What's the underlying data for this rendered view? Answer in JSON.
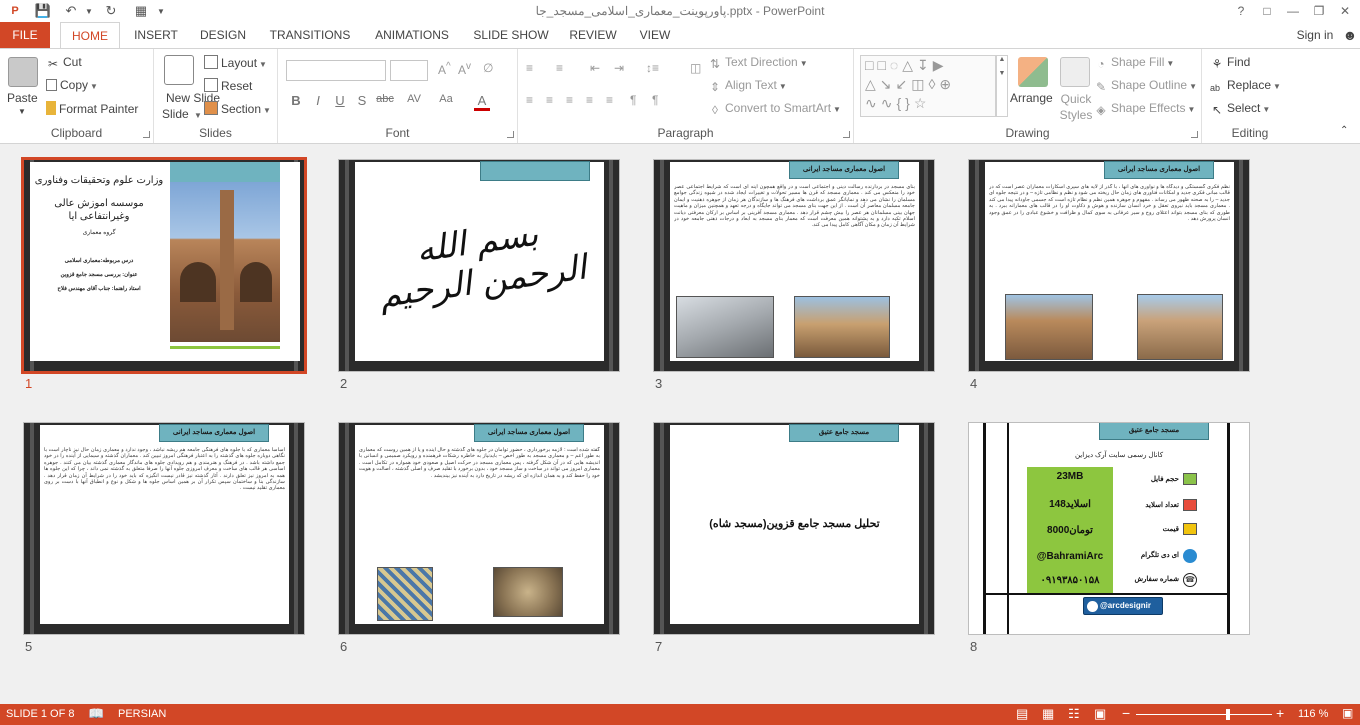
{
  "window": {
    "title": "پاورپوینت_معماری_اسلامی_مسجد_جا.pptx - PowerPoint",
    "help": "?",
    "sign_in": "Sign in"
  },
  "tabs": [
    "FILE",
    "HOME",
    "INSERT",
    "DESIGN",
    "TRANSITIONS",
    "ANIMATIONS",
    "SLIDE SHOW",
    "REVIEW",
    "VIEW"
  ],
  "ribbon": {
    "clipboard": {
      "label": "Clipboard",
      "paste": "Paste",
      "cut": "Cut",
      "copy": "Copy",
      "format_painter": "Format Painter"
    },
    "slides": {
      "label": "Slides",
      "new_slide": "New Slide",
      "layout": "Layout",
      "reset": "Reset",
      "section": "Section"
    },
    "font": {
      "label": "Font",
      "bold": "B",
      "italic": "I",
      "underline": "U",
      "shadow": "S",
      "strike": "abc",
      "spacing": "AV",
      "case": "Aa",
      "color": "A"
    },
    "paragraph": {
      "label": "Paragraph",
      "text_direction": "Text Direction",
      "align_text": "Align Text",
      "convert_smartart": "Convert to SmartArt"
    },
    "drawing": {
      "label": "Drawing",
      "arrange": "Arrange",
      "quick_styles": "Quick Styles",
      "shape_fill": "Shape Fill",
      "shape_outline": "Shape Outline",
      "shape_effects": "Shape Effects"
    },
    "editing": {
      "label": "Editing",
      "find": "Find",
      "replace": "Replace",
      "select": "Select"
    }
  },
  "slides": [
    {
      "number": "1",
      "lines": [
        "وزارت علوم وتحقیقات وفناوری",
        "موسسه اموزش عالی وغیرانتفاعی ایا",
        "گروه معماری",
        "درس مربوطه:معماری اسلامی",
        "عنوان: بررسی مسجد جامع قزوین",
        "استاد راهنما: جناب آقای مهندس فلاح"
      ]
    },
    {
      "number": "2",
      "calligraphy": "بسم الله الرحمن الرحیم"
    },
    {
      "number": "3",
      "heading": "اصول معماری مساجد ایرانی",
      "body": "بنای مسجد در بردارنده رسالت دینی و اجتماعی است و در واقع همچون آینه ای است که شرایط اجتماعی عصر خود را منعکس می کند . معماری مسجد که قرن ها مسیر تحولات و تغییرات ایجاد شده در شیوه زندگی جوامع مسلمان را نشان می دهد و نمایانگر عمق برداشت های فرهنگ ها و سازندگان هر زمان از جوهره ذهنیت و ایمان جامعه مسلمان معاصر آن است . از این جهت بنای مسجد می تواند جایگاه و درجه تعهد و همچنین میزان و ماهیت جهان بینی مسلمانان هر عصر را بیش چشم قرار دهد . معماری مسجد آفرینی بر اساس بر ارکان معرفتی دیانت اسلام تکیه دارد و به پشتوانه همین معرفت است که معمار بنای مسجد به ابعاد و درجات ذهنی جامعه خود در شرایط آن زمان و مکان آگاهی کامل پیدا می کند."
    },
    {
      "number": "4",
      "heading": "اصول معماری مساجد ایرانی",
      "body": "نظم فکری گسستگی و دیدگاه ها و نوآوری های آنها ، با گذر از لایه های سپری اسکارات معماران عصر است که در قالب مبانی فکری جدید و امکانات فناوری های زمان حال ریخته می شود و نظم و نظامی تازه – و در نتیجه جلوه ای جدید – را به صحنه ظهور می رساند . مفهوم و جوهره همین نظم و نظام تازه است که جسمی جاودانه پیدا می کند . معماری مسجد باید نیروی تعقل و خرد انسان سازنده و هوش و ذکاوت او را در قالب های معمارانه ببرد . به طوری که بنای مسجد بتواند اعتلای روح و سیر عرفانی به سوی کمال و ظرافت و خشوع عبادی را در عمق وجود انسان پرورش دهد ."
    },
    {
      "number": "5",
      "heading": "اصول معماری مساجد ایرانی",
      "body": "اساسا معماری که با جلوه های فرهنگی جامعه هم ریشه نباشد ، وجود ندارد و معماری زمان حال نیز ناچار است با نگاهی دوباره جلوه های گذشته را به اعتبار فرهنگی امروز تبیین کند . معماران گذشته و سیمایی از آینده را در خود جمع داشته باشد . در فرهنگ و هنرمندی و هم رویدادی جلوه های ماندگار معماری گذشته بیان می کنند . جوهره اساسی هر قالب های ساخت و معرف امروزی جلوه آنها را صرفا متعلق به گذشته نمی داند ، چرا که این جلوه ها همه به امروز نیز تعلق دارند . آثار گذشته نیز قادر نیست انگیزه که باید خود را در شرایط آن زمان قرار دهد . سازندگی بنا و ساختمان سپس تکرار آن بر همین اساس جلوه ها و شکل و نوع و انطباق آنها با دست بر روی معماری تقلید نیست ."
    },
    {
      "number": "6",
      "heading": "اصول معماری مساجد ایرانی",
      "body": "گفته شده است : لازمه برخورداری ، حضور توامان در جلوه های گذشته و حال آینده و یا از همین روست که معماری به طور اعم – و معماری مسجد به طور اخص – بایدنیاز به خاطره رشکات فرهمنده و رویکرد صمیمی و انسانی با اندیشه هایی که در آن شکل گرفته ، پس معماری مسجد در حرکت اصیل و صعودی خود همواره در تکامل است . معماری امروز می تواند در ساخت و ساز مسجد خود ، بدون برخورد با تقلید صرف و اصلی گذشته ، اصالت و هویت خود را حفظ کند و به همان اندازه ای که ریشه در تاریخ دارد به آینده نیز بیندیشد ."
    },
    {
      "number": "7",
      "heading": "مسجد جامع عتیق",
      "center": "تحلیل مسجد جامع قزوین(مسجد شاه)"
    },
    {
      "number": "8",
      "heading": "مسجد جامع عتیق",
      "channel": "کانال رسمی سایت آرک دیزاین",
      "rows": [
        {
          "label": "حجم فایل",
          "value": "23MB"
        },
        {
          "label": "تعداد اسلاید",
          "value": "148اسلاید"
        },
        {
          "label": "قیمت",
          "value": "8000تومان"
        },
        {
          "label": "ای دی تلگرام",
          "value": "@BahramiArc"
        },
        {
          "label": "شماره سفارش",
          "value": "۰۹۱۹۳۸۵۰۱۵۸"
        }
      ],
      "telegram": "@arcdesignir"
    }
  ],
  "status": {
    "slide": "SLIDE 1 OF 8",
    "language": "PERSIAN",
    "zoom": "116 %"
  },
  "colors": {
    "accent": "#d24726",
    "slide_head": "#6fb3bf",
    "price_box": "#8dc63f"
  }
}
